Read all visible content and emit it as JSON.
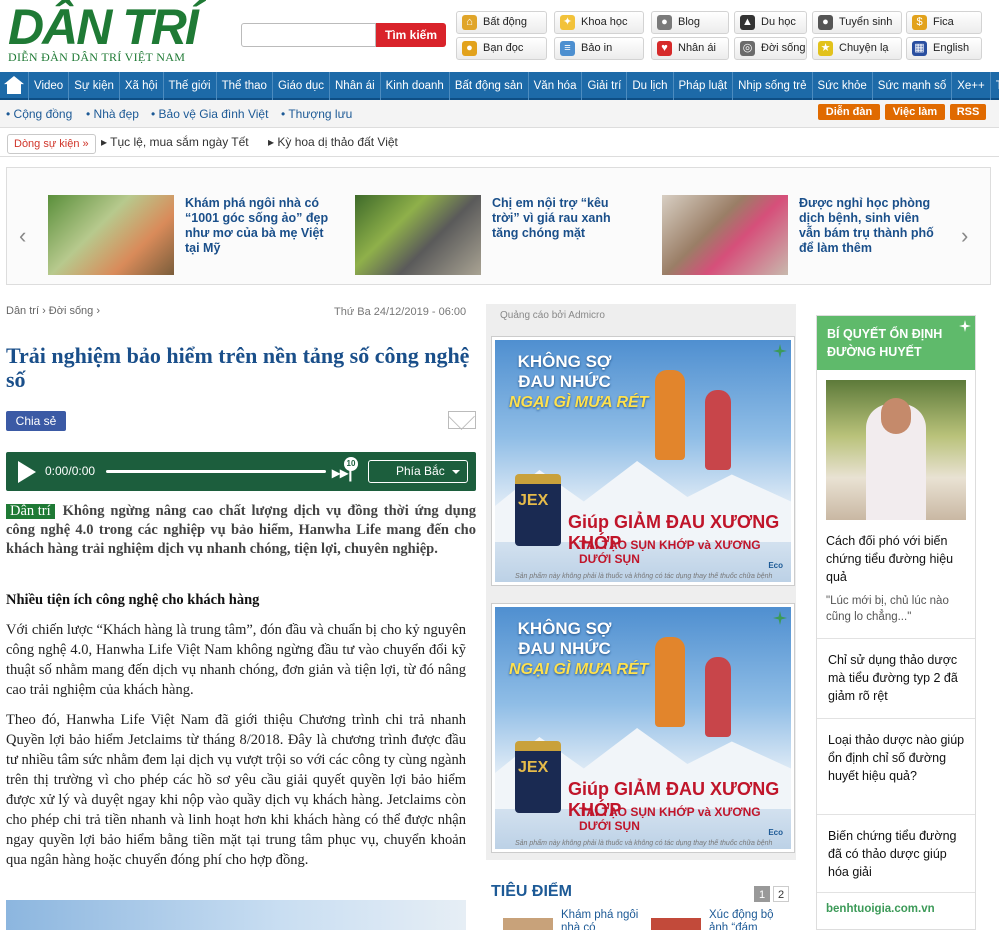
{
  "header": {
    "logo": "DÂN TRÍ",
    "logo_sub": "DIỄN ĐÀN DÂN TRÍ VIỆT NAM",
    "search_placeholder": "",
    "search_button": "Tìm kiếm",
    "quick_links": [
      "Bất động sản",
      "Khoa học",
      "Blog",
      "Du học",
      "Tuyển sinh",
      "Fica",
      "Bạn đọc",
      "Bảo in",
      "Nhân ái",
      "Đời sống",
      "Chuyện lạ",
      "English"
    ]
  },
  "main_nav": [
    "Video",
    "Sự kiện",
    "Xã hội",
    "Thế giới",
    "Thể thao",
    "Giáo dục",
    "Nhân ái",
    "Kinh doanh",
    "Bất động sản",
    "Văn hóa",
    "Giải trí",
    "Du lịch",
    "Pháp luật",
    "Nhịp sống trẻ",
    "Sức khỏe",
    "Sức mạnh số",
    "Xe++",
    "Tình yêu"
  ],
  "sub_nav": [
    "Cộng đồng",
    "Nhà đẹp",
    "Bảo vệ Gia đình Việt",
    "Thượng lưu"
  ],
  "tags": [
    "Diễn đàn",
    "Việc làm",
    "RSS"
  ],
  "events": {
    "label": "Dòng sự kiện »",
    "items": [
      "Tục lệ, mua sắm ngày Tết",
      "Kỳ hoa dị thảo đất Việt"
    ]
  },
  "featured": [
    {
      "title": "Khám phá ngôi nhà có “1001 góc sống ảo” đẹp như mơ của bà mẹ Việt tại Mỹ"
    },
    {
      "title": "Chị em nội trợ “kêu trời” vì giá rau xanh tăng chóng mặt"
    },
    {
      "title": "Được nghỉ học phòng dịch bệnh, sinh viên vẫn bám trụ thành phố để làm thêm"
    }
  ],
  "article": {
    "breadcrumb": "Dân trí ›  Đời sống ›",
    "date": "Thứ Ba 24/12/2019 - 06:00",
    "title": "Trải nghiệm bảo hiểm trên nền tảng số công nghệ số",
    "share": "Chia sẻ",
    "player": {
      "time": "0:00/0:00",
      "badge": "10",
      "voice": "Phía Bắc"
    },
    "source": "Dân trí",
    "lead": "Không ngừng nâng cao chất lượng dịch vụ đồng thời ứng dụng công nghệ 4.0 trong các nghiệp vụ bảo hiểm, Hanwha Life mang đến cho khách hàng trải nghiệm dịch vụ nhanh chóng, tiện lợi, chuyên nghiệp.",
    "subheading": "Nhiều tiện ích công nghệ cho khách hàng",
    "paragraphs": [
      "Với chiến lược “Khách hàng là trung tâm”, đón đầu và chuẩn bị cho kỷ nguyên công nghệ 4.0, Hanwha Life Việt Nam không ngừng đầu tư vào chuyển đổi kỹ thuật số nhằm mang đến dịch vụ nhanh chóng, đơn giản và tiện lợi, từ đó nâng cao trải nghiệm của khách hàng.",
      "Theo đó, Hanwha Life Việt Nam đã giới thiệu Chương trình chi trả nhanh Quyền lợi bảo hiểm Jetclaims từ tháng 8/2018. Đây là chương trình được đầu tư nhiều tâm sức nhằm đem lại dịch vụ vượt trội so với các công ty cùng ngành trên thị trường vì cho phép các hồ sơ yêu cầu giải quyết quyền lợi bảo hiểm được xử lý và duyệt ngay khi nộp vào quầy dịch vụ khách hàng. Jetclaims còn cho phép chi trả tiền nhanh và linh hoạt hơn khi khách hàng có thể được nhận ngay quyền lợi bảo hiểm bằng tiền mặt tại trung tâm phục vụ, chuyển khoản qua ngân hàng hoặc chuyển đóng phí cho hợp đồng."
    ]
  },
  "ads": {
    "label": "Quảng cáo bởi Admicro",
    "banner": {
      "l1": "KHÔNG SỢ ĐAU NHỨC",
      "l2": "NGẠI GÌ MƯA RÉT",
      "product": "JEX",
      "l3": "Giúp GIẢM ĐAU XƯƠNG KHỚP",
      "l4": "TÁI TẠO SỤN KHỚP và XƯƠNG DƯỚI SỤN",
      "disclaimer": "Sản phẩm này không phải là thuốc và không có tác dụng thay thế thuốc chữa bệnh",
      "brand": "Eco"
    }
  },
  "tieu_diem": {
    "title": "TIÊU ĐIỂM",
    "pages": [
      "1",
      "2"
    ],
    "items": [
      "Khám phá ngôi nhà có",
      "Xúc động bộ ảnh “đám"
    ]
  },
  "right_panel": {
    "header": "BÍ QUYẾT ỔN ĐỊNH ĐƯỜNG HUYẾT",
    "feature_title": "Cách đối phó với biến chứng tiểu đường hiệu quả",
    "quote": "\"Lúc mới bị, chủ lúc nào cũng lo chẳng...\"",
    "items": [
      "Chỉ sử dụng thảo dược mà tiểu đường typ 2 đã giảm rõ rệt",
      "Loại thảo dược nào giúp ổn định chỉ số đường huyết hiệu quả?",
      "Biến chứng tiểu đường đã có thảo dược giúp hóa giải"
    ],
    "footer": "benhtuoigia.com.vn"
  },
  "colors": {
    "brand_green": "#1f7a35",
    "nav_blue": "#1d6aa8",
    "title_blue": "#1a4f8a",
    "search_red": "#d9232a",
    "tag_orange": "#e06a00",
    "panel_green": "#5fba6b"
  }
}
